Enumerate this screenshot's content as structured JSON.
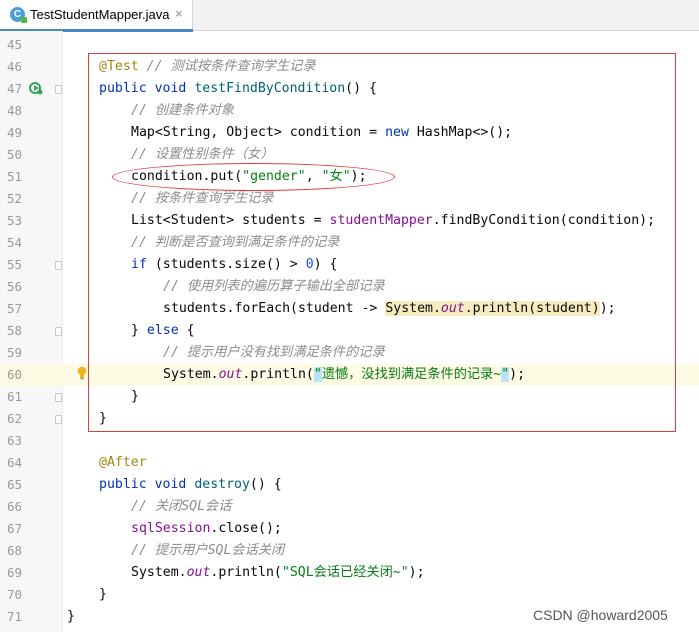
{
  "tab": {
    "filename": "TestStudentMapper.java",
    "icon_letter": "C",
    "close_label": "×"
  },
  "editor": {
    "lines": [
      {
        "n": "45",
        "tokens": []
      },
      {
        "n": "46",
        "tokens": [
          {
            "t": "@Test",
            "c": "ann"
          },
          {
            "t": " "
          },
          {
            "t": "// 测试按条件查询学生记录",
            "c": "cm"
          }
        ]
      },
      {
        "n": "47",
        "tokens": [
          {
            "t": "public",
            "c": "kw"
          },
          {
            "t": " "
          },
          {
            "t": "void",
            "c": "kw"
          },
          {
            "t": " "
          },
          {
            "t": "testFindByCondition",
            "c": "fn"
          },
          {
            "t": "() {"
          }
        ]
      },
      {
        "n": "48",
        "tokens": [
          {
            "t": "// 创建条件对象",
            "c": "cm"
          }
        ]
      },
      {
        "n": "49",
        "tokens": [
          {
            "t": "Map<String, Object> condition = "
          },
          {
            "t": "new",
            "c": "kw"
          },
          {
            "t": " HashMap<>();"
          }
        ]
      },
      {
        "n": "50",
        "tokens": [
          {
            "t": "// 设置性别条件（女）",
            "c": "cm"
          }
        ]
      },
      {
        "n": "51",
        "tokens": [
          {
            "t": "condition.put("
          },
          {
            "t": "\"gender\"",
            "c": "str"
          },
          {
            "t": ", "
          },
          {
            "t": "\"女\"",
            "c": "str"
          },
          {
            "t": ");"
          }
        ]
      },
      {
        "n": "52",
        "tokens": [
          {
            "t": "// 按条件查询学生记录",
            "c": "cm"
          }
        ]
      },
      {
        "n": "53",
        "tokens": [
          {
            "t": "List<Student> students = "
          },
          {
            "t": "studentMapper",
            "c": "field"
          },
          {
            "t": ".findByCondition(condition);"
          }
        ]
      },
      {
        "n": "54",
        "tokens": [
          {
            "t": "// 判断是否查询到满足条件的记录",
            "c": "cm"
          }
        ]
      },
      {
        "n": "55",
        "tokens": [
          {
            "t": "if",
            "c": "kw"
          },
          {
            "t": " (students.size() > "
          },
          {
            "t": "0",
            "c": "num"
          },
          {
            "t": ") {"
          }
        ]
      },
      {
        "n": "56",
        "tokens": [
          {
            "t": "// 使用列表的遍历算子输出全部记录",
            "c": "cm"
          }
        ]
      },
      {
        "n": "57",
        "tokens": [
          {
            "t": "students.forEach(student -> "
          },
          {
            "t": "System.",
            "c": "hlbg"
          },
          {
            "t": "out",
            "c": "st hlbg"
          },
          {
            "t": ".println(student)",
            "c": "hlbg"
          },
          {
            "t": ");"
          }
        ]
      },
      {
        "n": "58",
        "tokens": [
          {
            "t": "} "
          },
          {
            "t": "else",
            "c": "kw"
          },
          {
            "t": " {"
          }
        ]
      },
      {
        "n": "59",
        "tokens": [
          {
            "t": "// 提示用户没有找到满足条件的记录",
            "c": "cm"
          }
        ]
      },
      {
        "n": "60",
        "tokens": [
          {
            "t": "System."
          },
          {
            "t": "out",
            "c": "st"
          },
          {
            "t": ".println("
          },
          {
            "t": "\"遗憾，没找到满足条件的记录~\"",
            "c": "str brk-open"
          },
          {
            "t": ");"
          }
        ]
      },
      {
        "n": "61",
        "tokens": [
          {
            "t": "}"
          }
        ]
      },
      {
        "n": "62",
        "tokens": [
          {
            "t": "}"
          }
        ]
      },
      {
        "n": "63",
        "tokens": []
      },
      {
        "n": "64",
        "tokens": [
          {
            "t": "@After",
            "c": "ann"
          }
        ]
      },
      {
        "n": "65",
        "tokens": [
          {
            "t": "public",
            "c": "kw"
          },
          {
            "t": " "
          },
          {
            "t": "void",
            "c": "kw"
          },
          {
            "t": " "
          },
          {
            "t": "destroy",
            "c": "fn"
          },
          {
            "t": "() {"
          }
        ]
      },
      {
        "n": "66",
        "tokens": [
          {
            "t": "// 关闭SQL会话",
            "c": "cm"
          }
        ]
      },
      {
        "n": "67",
        "tokens": [
          {
            "t": "sqlSession",
            "c": "field"
          },
          {
            "t": ".close();"
          }
        ]
      },
      {
        "n": "68",
        "tokens": [
          {
            "t": "// 提示用户SQL会话关闭",
            "c": "cm"
          }
        ]
      },
      {
        "n": "69",
        "tokens": [
          {
            "t": "System."
          },
          {
            "t": "out",
            "c": "st"
          },
          {
            "t": ".println("
          },
          {
            "t": "\"SQL会话已经关闭~\"",
            "c": "str"
          },
          {
            "t": ");"
          }
        ]
      },
      {
        "n": "70",
        "tokens": [
          {
            "t": "}"
          }
        ]
      },
      {
        "n": "71",
        "tokens": [
          {
            "t": "}"
          }
        ]
      }
    ],
    "highlighted_line": "60"
  },
  "watermark": "CSDN @howard2005",
  "colors": {
    "annotation_box": "#e03c3c",
    "tab_accent": "#4a88c7"
  }
}
